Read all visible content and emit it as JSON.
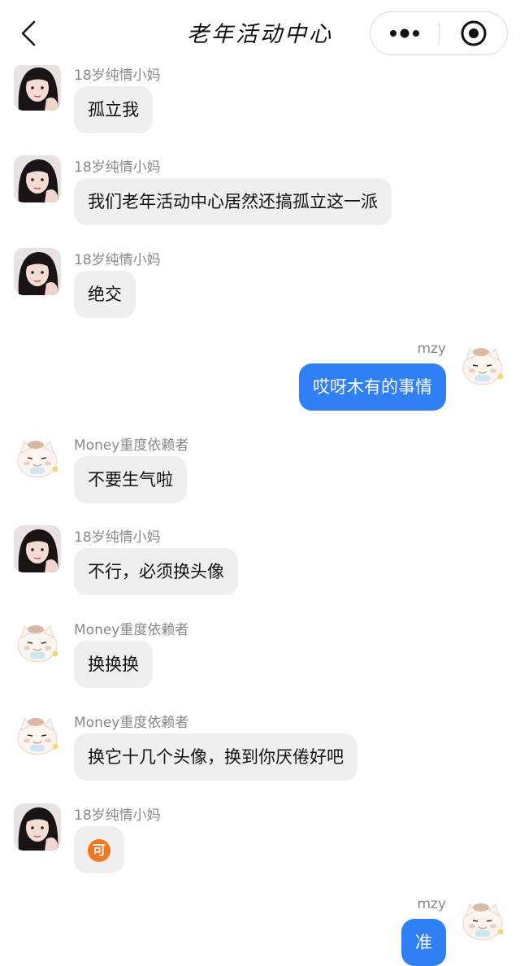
{
  "navbar": {
    "title": "老年活动中心"
  },
  "messages": [
    {
      "side": "left",
      "sender": "18岁纯情小妈",
      "text": "孤立我",
      "avatar": "girl-avatar"
    },
    {
      "side": "left",
      "sender": "18岁纯情小妈",
      "text": "我们老年活动中心居然还搞孤立这一派",
      "avatar": "girl-avatar"
    },
    {
      "side": "left",
      "sender": "18岁纯情小妈",
      "text": "绝交",
      "avatar": "girl-avatar"
    },
    {
      "side": "right",
      "sender": "mzy",
      "text": "哎呀木有的事情",
      "avatar": "cat-avatar"
    },
    {
      "side": "left",
      "sender": "Money重度依赖者",
      "text": "不要生气啦",
      "avatar": "cat-avatar"
    },
    {
      "side": "left",
      "sender": "18岁纯情小妈",
      "text": "不行，必须换头像",
      "avatar": "girl-avatar"
    },
    {
      "side": "left",
      "sender": "Money重度依赖者",
      "text": "换换换",
      "avatar": "cat-avatar"
    },
    {
      "side": "left",
      "sender": "Money重度依赖者",
      "text": "换它十几个头像，换到你厌倦好吧",
      "avatar": "cat-avatar"
    },
    {
      "side": "left",
      "sender": "18岁纯情小妈",
      "text": "可",
      "avatar": "girl-avatar",
      "emoji": true
    },
    {
      "side": "right",
      "sender": "mzy",
      "text": "准",
      "avatar": "cat-avatar"
    }
  ],
  "colors": {
    "self_bubble": "#2f80f5",
    "other_bubble": "#efefef",
    "sender_text": "#888888"
  }
}
